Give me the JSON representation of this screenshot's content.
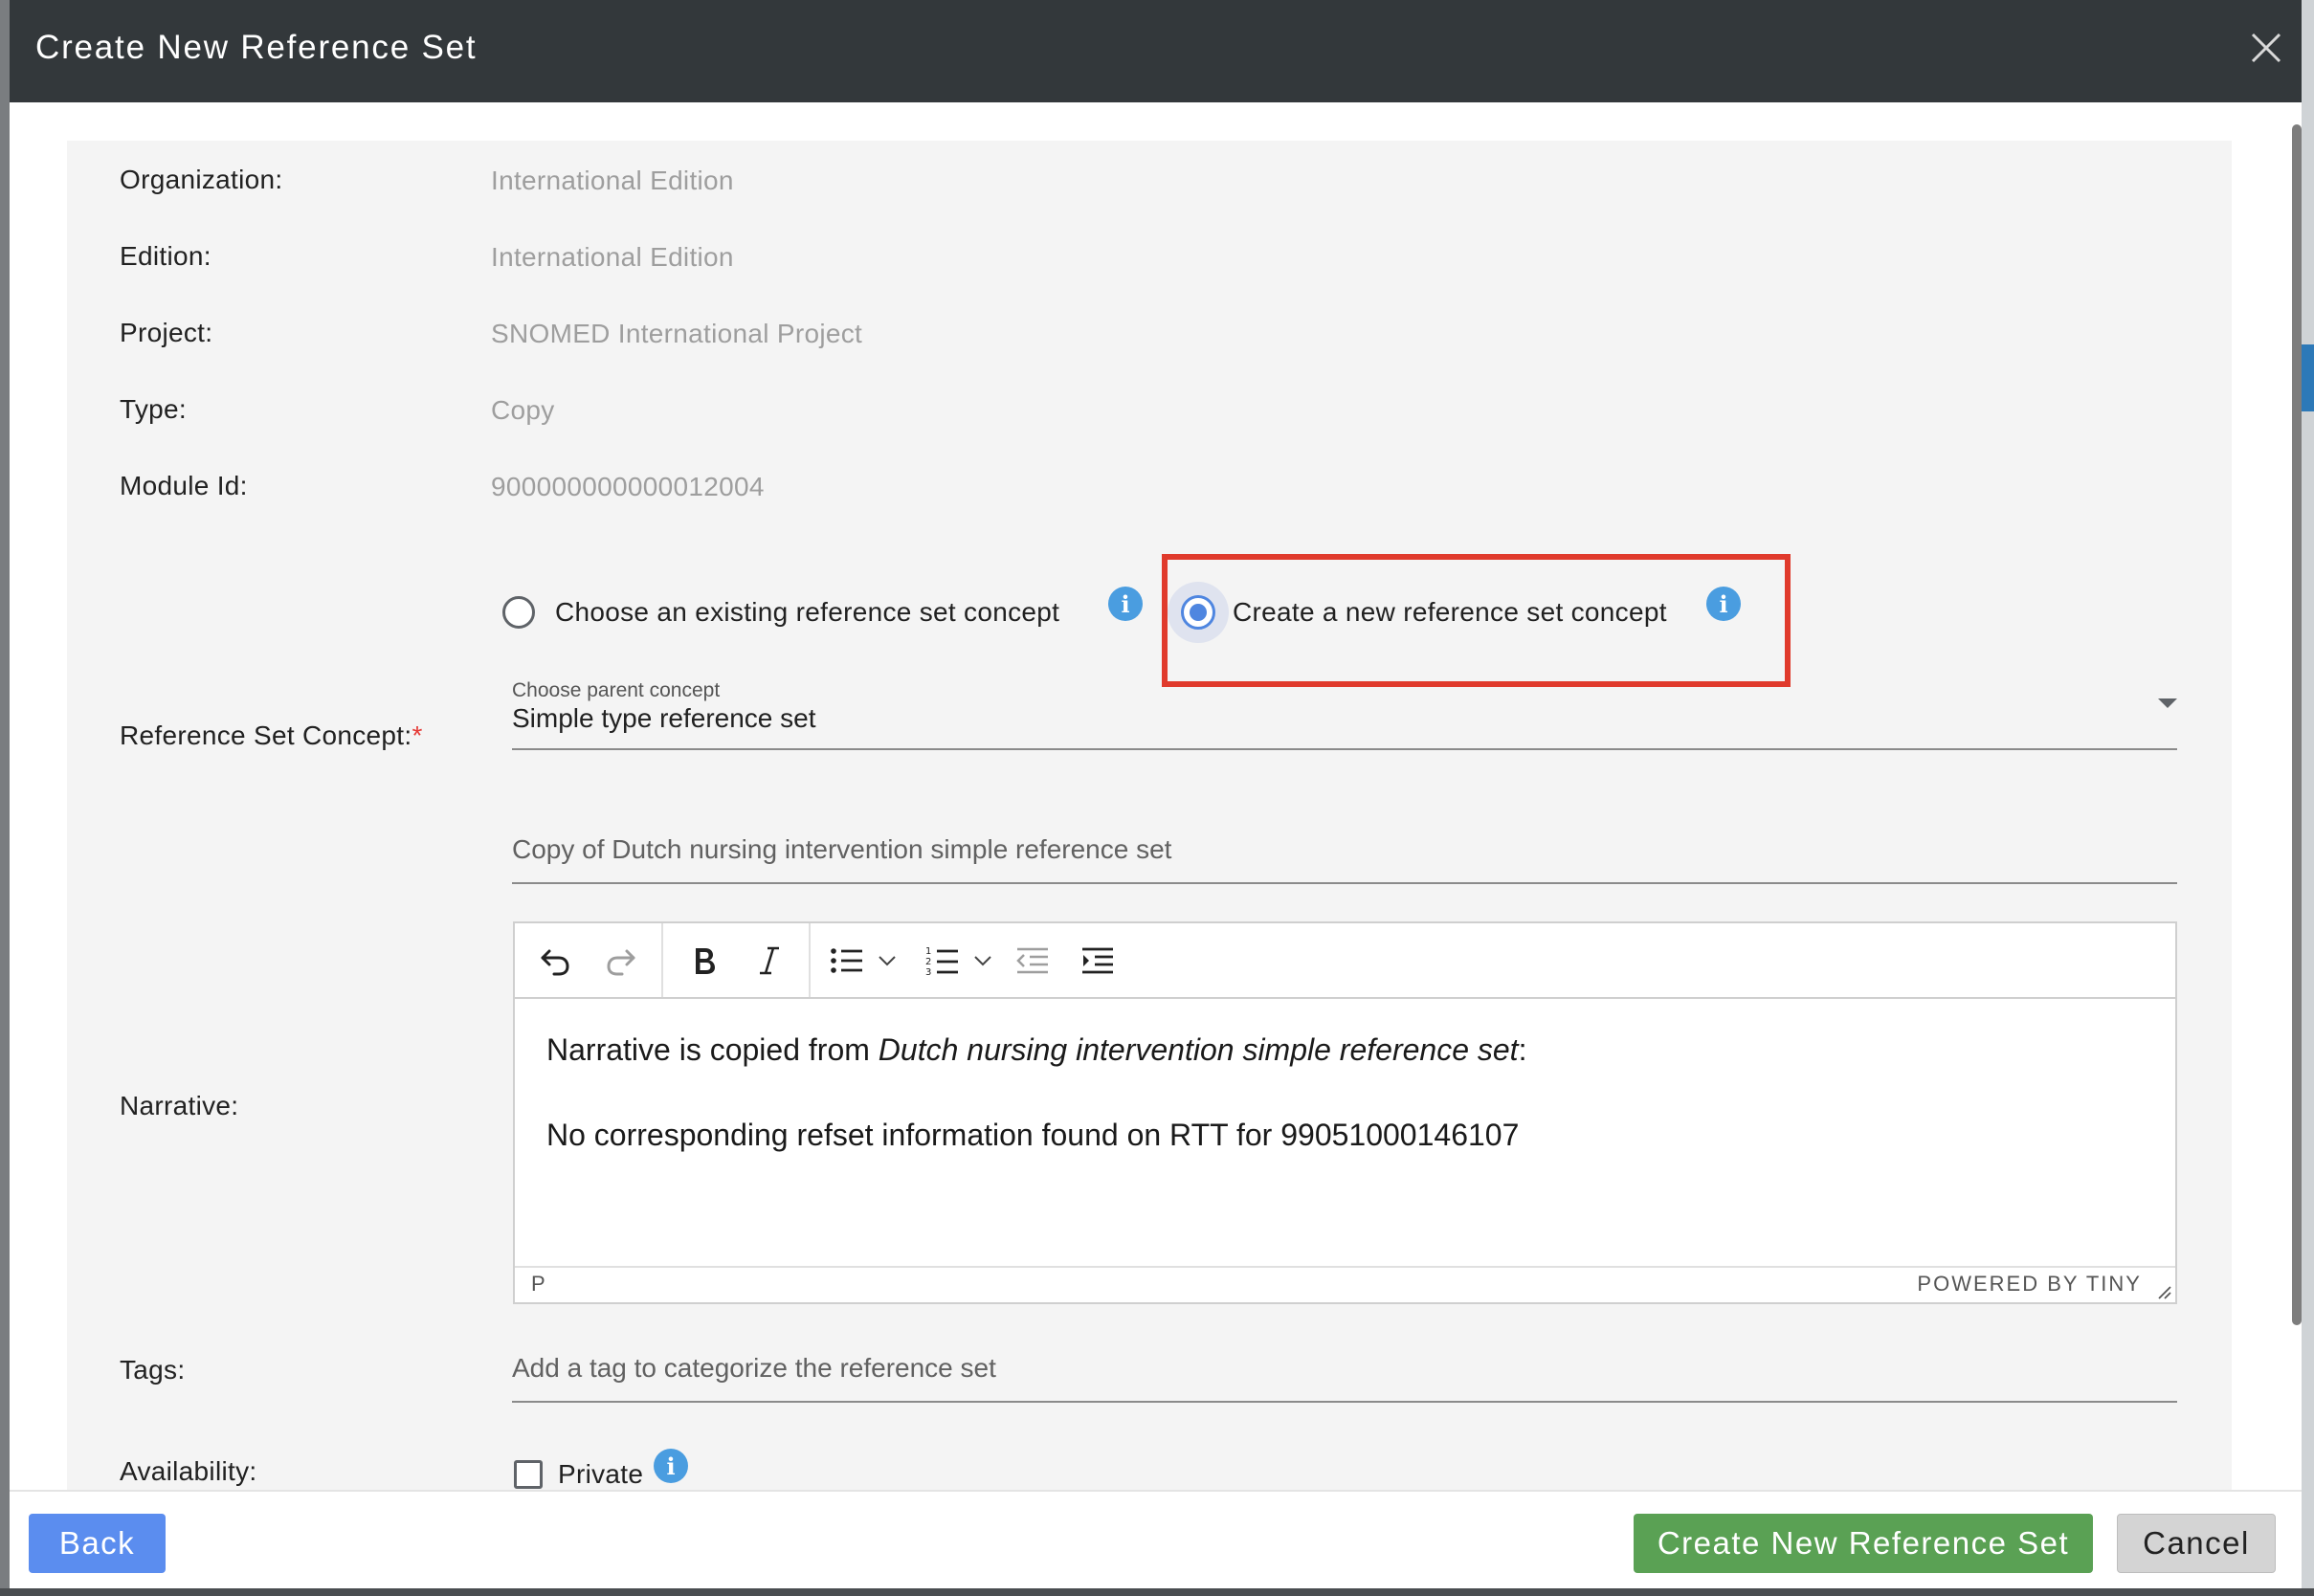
{
  "dialog": {
    "title": "Create New Reference Set"
  },
  "fields": {
    "organization": {
      "label": "Organization:",
      "value": "International Edition"
    },
    "edition": {
      "label": "Edition:",
      "value": "International Edition"
    },
    "project": {
      "label": "Project:",
      "value": "SNOMED International Project"
    },
    "type": {
      "label": "Type:",
      "value": "Copy"
    },
    "module_id": {
      "label": "Module Id:",
      "value": "900000000000012004"
    }
  },
  "refset_concept": {
    "label": "Reference Set Concept:",
    "required_marker": "*",
    "option_existing": "Choose an existing reference set concept",
    "option_new": "Create a new reference set concept",
    "selected": "new",
    "parent_caption": "Choose parent concept",
    "parent_value": "Simple type reference set",
    "name_value": "Copy of Dutch nursing intervention simple reference set"
  },
  "narrative": {
    "label": "Narrative:",
    "line1_prefix": "Narrative is copied from ",
    "line1_italic": "Dutch nursing intervention simple reference set",
    "line1_suffix": ":",
    "line2": "No corresponding refset information found on RTT for 99051000146107",
    "status_path": "P",
    "status_brand": "POWERED BY TINY"
  },
  "tags": {
    "label": "Tags:",
    "placeholder": "Add a tag to categorize the reference set"
  },
  "availability": {
    "label": "Availability:",
    "private_label": "Private",
    "private_checked": false
  },
  "footer": {
    "back": "Back",
    "create": "Create New Reference Set",
    "cancel": "Cancel"
  },
  "icons": {
    "info": "i",
    "close": "close-icon"
  },
  "colors": {
    "header_bg": "#33383b",
    "highlight": "#e03a2c",
    "info_blue": "#4a9de0",
    "back_button": "#5b8def",
    "create_button": "#5aa154"
  }
}
